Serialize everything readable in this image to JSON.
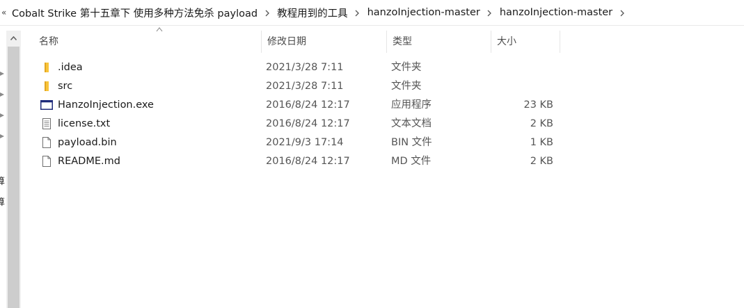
{
  "breadcrumb": {
    "overflow": "«",
    "items": [
      "Cobalt Strike 第十五章下 使用多种方法免杀 payload",
      "教程用到的工具",
      "hanzoInjection-master",
      "hanzoInjection-master"
    ]
  },
  "nav_partial_text": [
    "算",
    "算"
  ],
  "columns": {
    "name": "名称",
    "date": "修改日期",
    "type": "类型",
    "size": "大小"
  },
  "files": [
    {
      "name": ".idea",
      "date": "2021/3/28 7:11",
      "type": "文件夹",
      "size": "",
      "icon": "folder-icon"
    },
    {
      "name": "src",
      "date": "2021/3/28 7:11",
      "type": "文件夹",
      "size": "",
      "icon": "folder-icon"
    },
    {
      "name": "HanzoInjection.exe",
      "date": "2016/8/24 12:17",
      "type": "应用程序",
      "size": "23 KB",
      "icon": "application-icon"
    },
    {
      "name": "license.txt",
      "date": "2016/8/24 12:17",
      "type": "文本文档",
      "size": "2 KB",
      "icon": "text-document-icon"
    },
    {
      "name": "payload.bin",
      "date": "2021/9/3 17:14",
      "type": "BIN 文件",
      "size": "1 KB",
      "icon": "file-icon"
    },
    {
      "name": "README.md",
      "date": "2016/8/24 12:17",
      "type": "MD 文件",
      "size": "2 KB",
      "icon": "file-icon"
    }
  ],
  "colors": {
    "folder": "#f8c43a",
    "app_border": "#1f2b7a",
    "scroll_thumb": "#cdcdcd"
  }
}
